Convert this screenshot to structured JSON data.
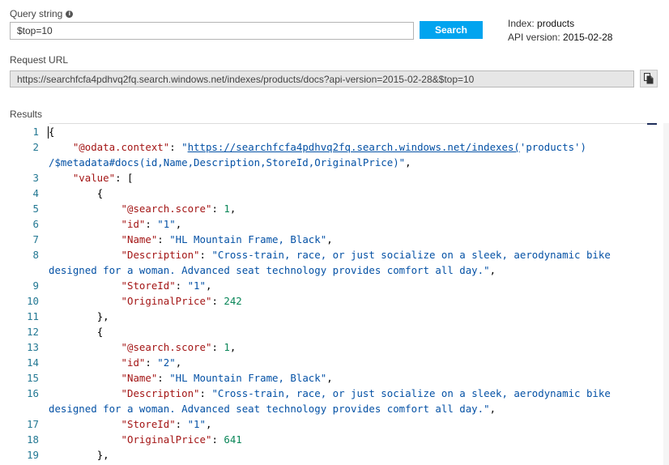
{
  "query": {
    "label": "Query string",
    "info_icon": "i",
    "value": "$top=10",
    "search_label": "Search"
  },
  "index_info": {
    "index_label": "Index:",
    "index_value": "products",
    "api_label": "API version:",
    "api_value": "2015-02-28"
  },
  "request": {
    "label": "Request URL",
    "url": "https://searchfcfa4pdhvq2fq.search.windows.net/indexes/products/docs?api-version=2015-02-28&$top=10",
    "copy_icon": "copy-icon"
  },
  "results": {
    "label": "Results",
    "lines": [
      {
        "n": "1",
        "indent": 0,
        "parts": [
          [
            "p",
            "{"
          ]
        ]
      },
      {
        "n": "2",
        "indent": 4,
        "parts": [
          [
            "k",
            "\"@odata.context\""
          ],
          [
            "p",
            ": "
          ],
          [
            "s",
            "\""
          ],
          [
            "u",
            "https://searchfcfa4pdhvq2fq.search.windows.net/indexes("
          ],
          [
            "s",
            "'products')"
          ]
        ]
      },
      {
        "n": "",
        "indent": 0,
        "parts": [
          [
            "s",
            "/$metadata#docs(id,Name,Description,StoreId,OriginalPrice)\""
          ],
          [
            "p",
            ","
          ]
        ]
      },
      {
        "n": "3",
        "indent": 4,
        "parts": [
          [
            "k",
            "\"value\""
          ],
          [
            "p",
            ": ["
          ]
        ]
      },
      {
        "n": "4",
        "indent": 8,
        "parts": [
          [
            "p",
            "{"
          ]
        ]
      },
      {
        "n": "5",
        "indent": 12,
        "parts": [
          [
            "k",
            "\"@search.score\""
          ],
          [
            "p",
            ": "
          ],
          [
            "n",
            "1"
          ],
          [
            "p",
            ","
          ]
        ]
      },
      {
        "n": "6",
        "indent": 12,
        "parts": [
          [
            "k",
            "\"id\""
          ],
          [
            "p",
            ": "
          ],
          [
            "s",
            "\"1\""
          ],
          [
            "p",
            ","
          ]
        ]
      },
      {
        "n": "7",
        "indent": 12,
        "parts": [
          [
            "k",
            "\"Name\""
          ],
          [
            "p",
            ": "
          ],
          [
            "s",
            "\"HL Mountain Frame, Black\""
          ],
          [
            "p",
            ","
          ]
        ]
      },
      {
        "n": "8",
        "indent": 12,
        "parts": [
          [
            "k",
            "\"Description\""
          ],
          [
            "p",
            ": "
          ],
          [
            "s",
            "\"Cross-train, race, or just socialize on a sleek, aerodynamic bike"
          ]
        ]
      },
      {
        "n": "",
        "indent": 0,
        "parts": [
          [
            "s",
            "designed for a woman. Advanced seat technology provides comfort all day.\""
          ],
          [
            "p",
            ","
          ]
        ]
      },
      {
        "n": "9",
        "indent": 12,
        "parts": [
          [
            "k",
            "\"StoreId\""
          ],
          [
            "p",
            ": "
          ],
          [
            "s",
            "\"1\""
          ],
          [
            "p",
            ","
          ]
        ]
      },
      {
        "n": "10",
        "indent": 12,
        "parts": [
          [
            "k",
            "\"OriginalPrice\""
          ],
          [
            "p",
            ": "
          ],
          [
            "n",
            "242"
          ]
        ]
      },
      {
        "n": "11",
        "indent": 8,
        "parts": [
          [
            "p",
            "},"
          ]
        ]
      },
      {
        "n": "12",
        "indent": 8,
        "parts": [
          [
            "p",
            "{"
          ]
        ]
      },
      {
        "n": "13",
        "indent": 12,
        "parts": [
          [
            "k",
            "\"@search.score\""
          ],
          [
            "p",
            ": "
          ],
          [
            "n",
            "1"
          ],
          [
            "p",
            ","
          ]
        ]
      },
      {
        "n": "14",
        "indent": 12,
        "parts": [
          [
            "k",
            "\"id\""
          ],
          [
            "p",
            ": "
          ],
          [
            "s",
            "\"2\""
          ],
          [
            "p",
            ","
          ]
        ]
      },
      {
        "n": "15",
        "indent": 12,
        "parts": [
          [
            "k",
            "\"Name\""
          ],
          [
            "p",
            ": "
          ],
          [
            "s",
            "\"HL Mountain Frame, Black\""
          ],
          [
            "p",
            ","
          ]
        ]
      },
      {
        "n": "16",
        "indent": 12,
        "parts": [
          [
            "k",
            "\"Description\""
          ],
          [
            "p",
            ": "
          ],
          [
            "s",
            "\"Cross-train, race, or just socialize on a sleek, aerodynamic bike"
          ]
        ]
      },
      {
        "n": "",
        "indent": 0,
        "parts": [
          [
            "s",
            "designed for a woman. Advanced seat technology provides comfort all day.\""
          ],
          [
            "p",
            ","
          ]
        ]
      },
      {
        "n": "17",
        "indent": 12,
        "parts": [
          [
            "k",
            "\"StoreId\""
          ],
          [
            "p",
            ": "
          ],
          [
            "s",
            "\"1\""
          ],
          [
            "p",
            ","
          ]
        ]
      },
      {
        "n": "18",
        "indent": 12,
        "parts": [
          [
            "k",
            "\"OriginalPrice\""
          ],
          [
            "p",
            ": "
          ],
          [
            "n",
            "641"
          ]
        ]
      },
      {
        "n": "19",
        "indent": 8,
        "parts": [
          [
            "p",
            "},"
          ]
        ]
      }
    ]
  },
  "colors": {
    "accent": "#01a4ef",
    "json_key": "#a31515",
    "json_string": "#0451a5",
    "json_number": "#098658",
    "line_number": "#237893"
  }
}
